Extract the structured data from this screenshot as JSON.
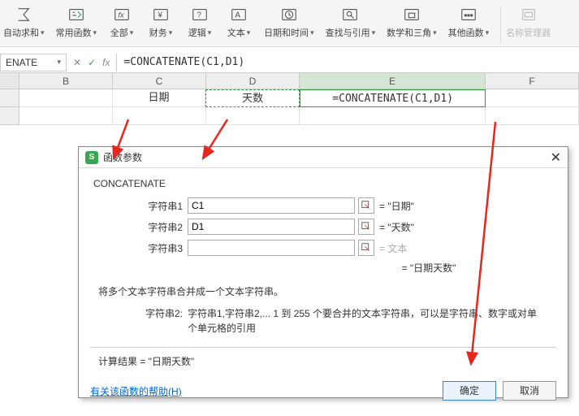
{
  "ribbon": {
    "items": [
      {
        "label": "自动求和"
      },
      {
        "label": "常用函数"
      },
      {
        "label": "全部"
      },
      {
        "label": "财务"
      },
      {
        "label": "逻辑"
      },
      {
        "label": "文本"
      },
      {
        "label": "日期和时间"
      },
      {
        "label": "查找与引用"
      },
      {
        "label": "数学和三角"
      },
      {
        "label": "其他函数"
      },
      {
        "label": "名称管理器"
      }
    ]
  },
  "formulaBar": {
    "nameBox": "ENATE",
    "formula": "=CONCATENATE(C1,D1)"
  },
  "columns": [
    "B",
    "C",
    "D",
    "E",
    "F"
  ],
  "row1": {
    "C": "日期",
    "D": "天数",
    "E": "=CONCATENATE(C1,D1)"
  },
  "dialog": {
    "title": "函数参数",
    "fnName": "CONCATENATE",
    "params": [
      {
        "label": "字符串1",
        "value": "C1",
        "result": "= \"日期\""
      },
      {
        "label": "字符串2",
        "value": "D1",
        "result": "= \"天数\""
      },
      {
        "label": "字符串3",
        "value": "",
        "result": "= 文本"
      }
    ],
    "midResult": "= \"日期天数\"",
    "desc1": "将多个文本字符串合并成一个文本字符串。",
    "desc2Label": "字符串2:",
    "desc2Text": "字符串1,字符串2,... 1 到 255 个要合并的文本字符串，可以是字符串、数字或对单个单元格的引用",
    "resultLabel": "计算结果 = \"日期天数\"",
    "helpLink": "有关该函数的帮助(H)",
    "ok": "确定",
    "cancel": "取消"
  }
}
